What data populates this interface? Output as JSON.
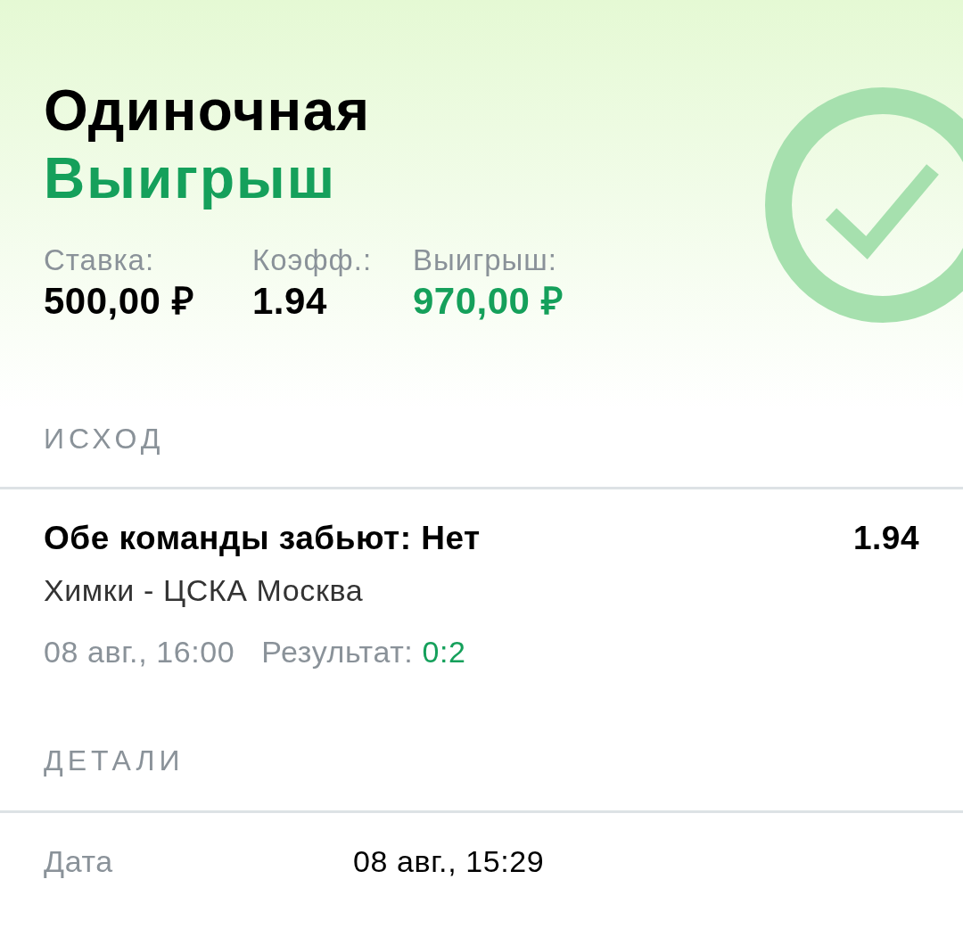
{
  "bet": {
    "type": "Одиночная",
    "status": {
      "kind": "won",
      "label": "Выигрыш"
    }
  },
  "summary": [
    {
      "kind": "plain",
      "label": "Ставка:",
      "value": "500,00 ₽"
    },
    {
      "kind": "plain",
      "label": "Коэфф.:",
      "value": "1.94"
    },
    {
      "kind": "win",
      "label": "Выигрыш:",
      "value": "970,00 ₽"
    }
  ],
  "outcome": {
    "heading": "ИСХОД",
    "selection": "Обе команды забьют: Нет",
    "odds": "1.94",
    "match": "Химки - ЦСКА Москва",
    "start_time": "08 авг., 16:00",
    "result_label": "Результат:",
    "result": "0:2"
  },
  "details": {
    "heading": "ДЕТАЛИ",
    "rows": [
      {
        "label": "Дата",
        "value": "08 авг., 15:29"
      }
    ]
  }
}
